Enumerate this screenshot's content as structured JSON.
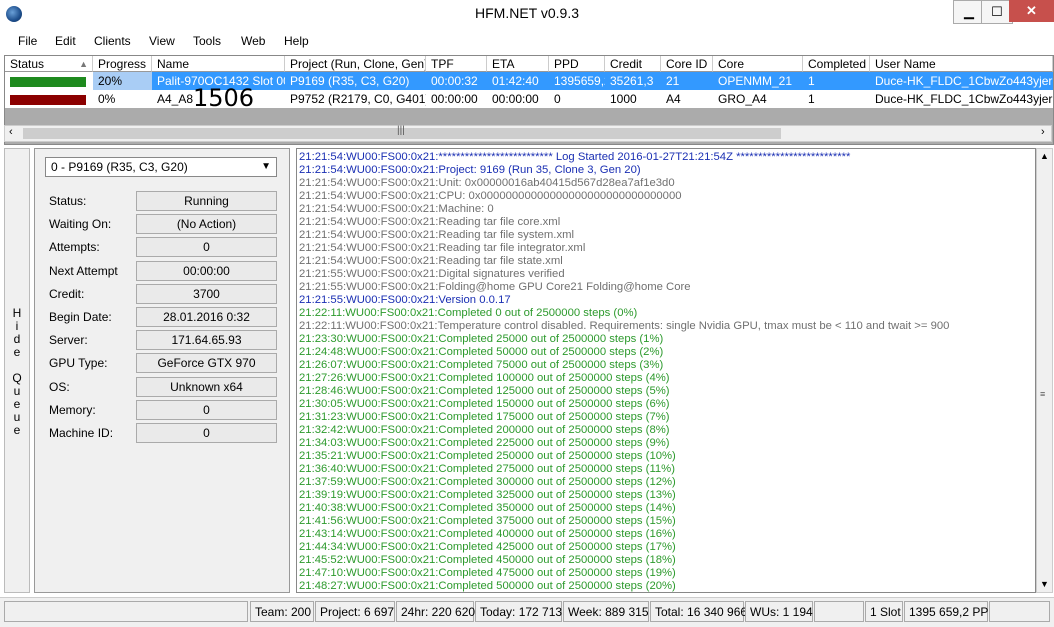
{
  "window": {
    "title": "HFM.NET v0.9.3"
  },
  "menu": [
    "File",
    "Edit",
    "Clients",
    "View",
    "Tools",
    "Web",
    "Help"
  ],
  "grid": {
    "headers": [
      "Status",
      "Progress",
      "Name",
      "Project (Run, Clone, Gen)",
      "TPF",
      "ETA",
      "PPD",
      "Credit",
      "Core ID",
      "Core",
      "Completed",
      "User Name"
    ],
    "rows": [
      {
        "status_color": "#1e8a1e",
        "progress": "20%",
        "name": "Palit-970OC1432 Slot 00",
        "project": "P9169 (R35, C3, G20)",
        "tpf": "00:00:32",
        "eta": "01:42:40",
        "ppd": "1395659,2",
        "credit": "35261,3",
        "core_id": "21",
        "core": "OPENMM_21",
        "completed": "1",
        "user": "Duce-HK_FLDC_1CbwZo443yjerS5JY"
      },
      {
        "status_color": "#8b0000",
        "progress": "0%",
        "name": "A4_A8",
        "project": "P9752 (R2179, C0, G401)",
        "tpf": "00:00:00",
        "eta": "00:00:00",
        "ppd": "0",
        "credit": "1000",
        "core_id": "A4",
        "core": "GRO_A4",
        "completed": "1",
        "user": "Duce-HK_FLDC_1CbwZo443yjerS5JY"
      }
    ],
    "overlay_number": "1506"
  },
  "hide_queue": "Hide Queue",
  "details": {
    "selected_wu": "0 - P9169 (R35, C3, G20)",
    "fields": [
      {
        "label": "Status:",
        "value": "Running"
      },
      {
        "label": "Waiting On:",
        "value": "(No Action)"
      },
      {
        "label": "Attempts:",
        "value": "0"
      },
      {
        "label": "Next Attempt",
        "value": "00:00:00"
      },
      {
        "label": "Credit:",
        "value": "3700"
      },
      {
        "label": "Begin Date:",
        "value": "28.01.2016 0:32"
      },
      {
        "label": "Server:",
        "value": "171.64.65.93"
      },
      {
        "label": "GPU Type:",
        "value": "GeForce GTX 970"
      },
      {
        "label": "OS:",
        "value": "Unknown x64"
      },
      {
        "label": "Memory:",
        "value": "0"
      },
      {
        "label": "Machine ID:",
        "value": "0"
      }
    ]
  },
  "log": [
    {
      "text": "21:21:54:WU00:FS00:0x21:************************** Log Started 2016-01-27T21:21:54Z **************************",
      "color": "#1a2fb3"
    },
    {
      "text": "21:21:54:WU00:FS00:0x21:Project: 9169 (Run 35, Clone 3, Gen 20)",
      "color": "#1a2fb3"
    },
    {
      "text": "21:21:54:WU00:FS00:0x21:Unit: 0x00000016ab40415d567d28ea7af1e3d0",
      "color": "#707070"
    },
    {
      "text": "21:21:54:WU00:FS00:0x21:CPU: 0x00000000000000000000000000000000",
      "color": "#707070"
    },
    {
      "text": "21:21:54:WU00:FS00:0x21:Machine: 0",
      "color": "#707070"
    },
    {
      "text": "21:21:54:WU00:FS00:0x21:Reading tar file core.xml",
      "color": "#707070"
    },
    {
      "text": "21:21:54:WU00:FS00:0x21:Reading tar file system.xml",
      "color": "#707070"
    },
    {
      "text": "21:21:54:WU00:FS00:0x21:Reading tar file integrator.xml",
      "color": "#707070"
    },
    {
      "text": "21:21:54:WU00:FS00:0x21:Reading tar file state.xml",
      "color": "#707070"
    },
    {
      "text": "21:21:55:WU00:FS00:0x21:Digital signatures verified",
      "color": "#707070"
    },
    {
      "text": "21:21:55:WU00:FS00:0x21:Folding@home GPU Core21 Folding@home Core",
      "color": "#707070"
    },
    {
      "text": "21:21:55:WU00:FS00:0x21:Version 0.0.17",
      "color": "#1a2fb3"
    },
    {
      "text": "21:22:11:WU00:FS00:0x21:Completed 0 out of 2500000 steps (0%)",
      "color": "#2d9a2d"
    },
    {
      "text": "21:22:11:WU00:FS00:0x21:Temperature control disabled. Requirements: single Nvidia GPU, tmax must be < 110 and twait >= 900",
      "color": "#707070"
    },
    {
      "text": "21:23:30:WU00:FS00:0x21:Completed 25000 out of 2500000 steps (1%)",
      "color": "#2d9a2d"
    },
    {
      "text": "21:24:48:WU00:FS00:0x21:Completed 50000 out of 2500000 steps (2%)",
      "color": "#2d9a2d"
    },
    {
      "text": "21:26:07:WU00:FS00:0x21:Completed 75000 out of 2500000 steps (3%)",
      "color": "#2d9a2d"
    },
    {
      "text": "21:27:26:WU00:FS00:0x21:Completed 100000 out of 2500000 steps (4%)",
      "color": "#2d9a2d"
    },
    {
      "text": "21:28:46:WU00:FS00:0x21:Completed 125000 out of 2500000 steps (5%)",
      "color": "#2d9a2d"
    },
    {
      "text": "21:30:05:WU00:FS00:0x21:Completed 150000 out of 2500000 steps (6%)",
      "color": "#2d9a2d"
    },
    {
      "text": "21:31:23:WU00:FS00:0x21:Completed 175000 out of 2500000 steps (7%)",
      "color": "#2d9a2d"
    },
    {
      "text": "21:32:42:WU00:FS00:0x21:Completed 200000 out of 2500000 steps (8%)",
      "color": "#2d9a2d"
    },
    {
      "text": "21:34:03:WU00:FS00:0x21:Completed 225000 out of 2500000 steps (9%)",
      "color": "#2d9a2d"
    },
    {
      "text": "21:35:21:WU00:FS00:0x21:Completed 250000 out of 2500000 steps (10%)",
      "color": "#2d9a2d"
    },
    {
      "text": "21:36:40:WU00:FS00:0x21:Completed 275000 out of 2500000 steps (11%)",
      "color": "#2d9a2d"
    },
    {
      "text": "21:37:59:WU00:FS00:0x21:Completed 300000 out of 2500000 steps (12%)",
      "color": "#2d9a2d"
    },
    {
      "text": "21:39:19:WU00:FS00:0x21:Completed 325000 out of 2500000 steps (13%)",
      "color": "#2d9a2d"
    },
    {
      "text": "21:40:38:WU00:FS00:0x21:Completed 350000 out of 2500000 steps (14%)",
      "color": "#2d9a2d"
    },
    {
      "text": "21:41:56:WU00:FS00:0x21:Completed 375000 out of 2500000 steps (15%)",
      "color": "#2d9a2d"
    },
    {
      "text": "21:43:14:WU00:FS00:0x21:Completed 400000 out of 2500000 steps (16%)",
      "color": "#2d9a2d"
    },
    {
      "text": "21:44:34:WU00:FS00:0x21:Completed 425000 out of 2500000 steps (17%)",
      "color": "#2d9a2d"
    },
    {
      "text": "21:45:52:WU00:FS00:0x21:Completed 450000 out of 2500000 steps (18%)",
      "color": "#2d9a2d"
    },
    {
      "text": "21:47:10:WU00:FS00:0x21:Completed 475000 out of 2500000 steps (19%)",
      "color": "#2d9a2d"
    },
    {
      "text": "21:48:27:WU00:FS00:0x21:Completed 500000 out of 2500000 steps (20%)",
      "color": "#2d9a2d"
    }
  ],
  "statusbar": {
    "team": "Team: 200",
    "project": "Project: 6 697",
    "h24": "24hr: 220 620",
    "today": "Today: 172 713",
    "week": "Week: 889 315",
    "total": "Total: 16 340 966",
    "wus": "WUs: 1 194",
    "slots": "1 Slot",
    "ppd": "1395 659,2 PPD"
  }
}
